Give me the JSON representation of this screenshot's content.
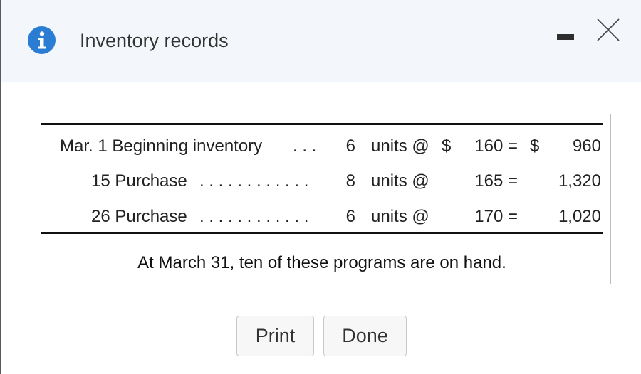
{
  "dialog": {
    "title": "Inventory records",
    "info_icon": "info-icon",
    "minimize_icon": "minimize-icon",
    "close_icon": "close-icon"
  },
  "table": {
    "rows": [
      {
        "label": "Mar. 1 Beginning inventory",
        "leader": ". . .",
        "qty": "6",
        "unit_text": "units @",
        "dollar": "$",
        "cost": "160 =",
        "total_dollar": "$",
        "total": "960"
      },
      {
        "label": "15 Purchase",
        "leader": ". . . . . . . . . . . .",
        "qty": "8",
        "unit_text": "units @",
        "dollar": "",
        "cost": "165 =",
        "total_dollar": "",
        "total": "1,320"
      },
      {
        "label": "26 Purchase",
        "leader": ". . . . . . . . . . . .",
        "qty": "6",
        "unit_text": "units @",
        "dollar": "",
        "cost": "170 =",
        "total_dollar": "",
        "total": "1,020"
      }
    ],
    "note": "At March 31, ten of these programs are on hand."
  },
  "buttons": {
    "print_label": "Print",
    "done_label": "Done"
  },
  "colors": {
    "accent": "#2b7cd3",
    "header_bg": "#f3f7fb"
  }
}
